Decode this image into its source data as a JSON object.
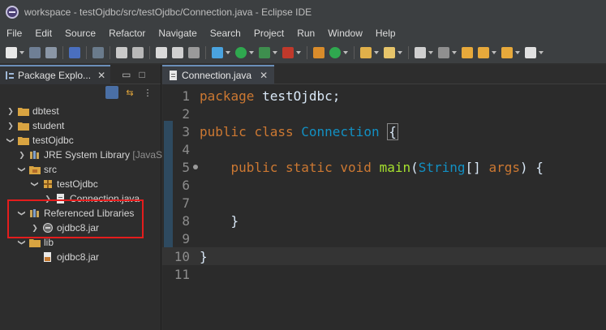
{
  "window": {
    "title": "workspace - testOjdbc/src/testOjdbc/Connection.java - Eclipse IDE"
  },
  "menu": [
    "File",
    "Edit",
    "Source",
    "Refactor",
    "Navigate",
    "Search",
    "Project",
    "Run",
    "Window",
    "Help"
  ],
  "left_panel": {
    "tab_label": "Package Explo...",
    "close": "✕",
    "minimize": "▭",
    "maximize": "□",
    "tree": [
      {
        "label": "dbtest",
        "type": "project",
        "expanded": false
      },
      {
        "label": "student",
        "type": "project",
        "expanded": false
      },
      {
        "label": "testOjdbc",
        "type": "project",
        "expanded": true
      },
      {
        "label": "JRE System Library",
        "suffix": "[JavaSE",
        "type": "library",
        "expanded": false
      },
      {
        "label": "src",
        "type": "folder",
        "expanded": true
      },
      {
        "label": "testOjdbc",
        "type": "package",
        "expanded": true
      },
      {
        "label": "Connection.java",
        "type": "java-file",
        "expanded": false
      },
      {
        "label": "Referenced Libraries",
        "type": "library",
        "expanded": true
      },
      {
        "label": "ojdbc8.jar",
        "type": "jar",
        "expanded": false
      },
      {
        "label": "lib",
        "type": "folder",
        "expanded": true
      },
      {
        "label": "ojdbc8.jar",
        "type": "jar",
        "expanded": false
      }
    ]
  },
  "editor": {
    "tab_label": "Connection.java",
    "close": "✕",
    "lines": [
      {
        "num": "1",
        "tokens": [
          [
            "kw",
            "package"
          ],
          [
            "pl",
            " testOjdbc;"
          ]
        ]
      },
      {
        "num": "2",
        "tokens": []
      },
      {
        "num": "3",
        "tokens": [
          [
            "kw",
            "public"
          ],
          [
            "pl",
            " "
          ],
          [
            "kw",
            "class"
          ],
          [
            "pl",
            " "
          ],
          [
            "typ",
            "Connection"
          ],
          [
            "pl",
            " "
          ],
          [
            "box",
            "{"
          ]
        ]
      },
      {
        "num": "4",
        "tokens": []
      },
      {
        "num": "5",
        "tokens": [
          [
            "pl",
            "    "
          ],
          [
            "kw",
            "public"
          ],
          [
            "pl",
            " "
          ],
          [
            "kw",
            "static"
          ],
          [
            "pl",
            " "
          ],
          [
            "kw",
            "void"
          ],
          [
            "pl",
            " "
          ],
          [
            "fn",
            "main"
          ],
          [
            "pl",
            "("
          ],
          [
            "typ",
            "String"
          ],
          [
            "pl",
            "[] "
          ],
          [
            "kw",
            "args"
          ],
          [
            "pl",
            ") {"
          ]
        ]
      },
      {
        "num": "6",
        "tokens": []
      },
      {
        "num": "7",
        "tokens": []
      },
      {
        "num": "8",
        "tokens": [
          [
            "pl",
            "    }"
          ]
        ]
      },
      {
        "num": "9",
        "tokens": []
      },
      {
        "num": "10",
        "tokens": [
          [
            "pl",
            "}"
          ]
        ]
      },
      {
        "num": "11",
        "tokens": []
      }
    ]
  },
  "colors": {
    "keyword": "#cc7832",
    "type": "#1290c3",
    "method": "#a6e22e",
    "highlight": "#e41d1d"
  }
}
